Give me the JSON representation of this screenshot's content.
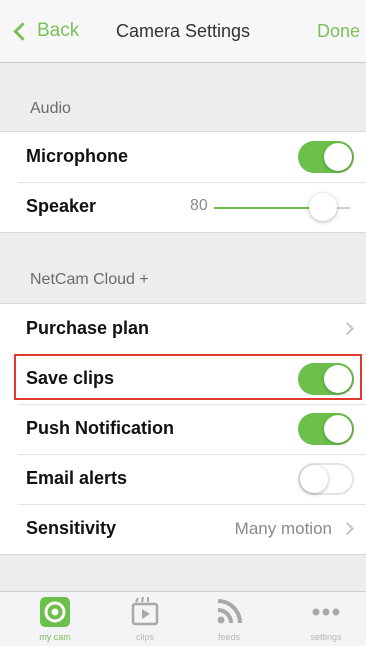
{
  "nav": {
    "back_label": "Back",
    "title": "Camera Settings",
    "done_label": "Done"
  },
  "sections": {
    "audio": "Audio",
    "cloud": "NetCam Cloud +"
  },
  "audio": {
    "microphone_label": "Microphone",
    "microphone_on": true,
    "speaker_label": "Speaker",
    "speaker_value": "80",
    "speaker_level": 0.8
  },
  "cloud": {
    "purchase_label": "Purchase plan",
    "save_clips_label": "Save clips",
    "save_clips_on": true,
    "push_label": "Push Notification",
    "push_on": true,
    "email_label": "Email alerts",
    "email_on": false,
    "sensitivity_label": "Sensitivity",
    "sensitivity_value": "Many motion"
  },
  "tabs": [
    {
      "label": "my cam",
      "icon": "camera-icon",
      "active": true
    },
    {
      "label": "clips",
      "icon": "clips-icon",
      "active": false
    },
    {
      "label": "feeds",
      "icon": "feeds-icon",
      "active": false
    },
    {
      "label": "settings",
      "icon": "more-icon",
      "active": false
    }
  ],
  "colors": {
    "accent": "#6cbf4a",
    "highlight": "#e23b2e"
  }
}
